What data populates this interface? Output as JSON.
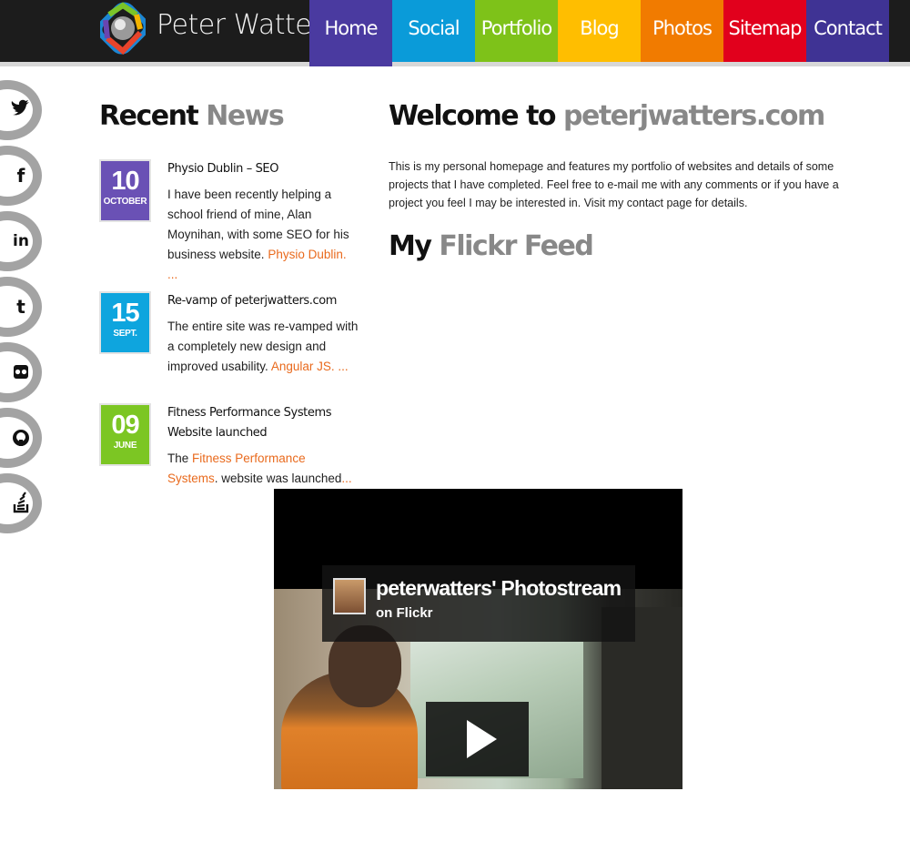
{
  "header": {
    "brand": "Peter Watters",
    "nav": [
      {
        "label": "Home",
        "color": "#4a3aa0",
        "active": true
      },
      {
        "label": "Social",
        "color": "#0a9bd9"
      },
      {
        "label": "Portfolio",
        "color": "#7ec219"
      },
      {
        "label": "Blog",
        "color": "#ffbe00"
      },
      {
        "label": "Photos",
        "color": "#f17b00"
      },
      {
        "label": "Sitemap",
        "color": "#e1001c"
      },
      {
        "label": "Contact",
        "color": "#3f3394"
      }
    ]
  },
  "social": {
    "items": [
      {
        "name": "twitter-icon",
        "glyph": "🐦"
      },
      {
        "name": "facebook-icon",
        "glyph": "f"
      },
      {
        "name": "linkedin-icon",
        "glyph": "in"
      },
      {
        "name": "tumblr-icon",
        "glyph": "t"
      },
      {
        "name": "flickr-icon",
        "glyph": "••"
      },
      {
        "name": "github-icon",
        "glyph": "◉"
      },
      {
        "name": "stackoverflow-icon",
        "glyph": "≡"
      }
    ]
  },
  "news": {
    "heading_main": "Recent",
    "heading_accent": "News",
    "items": [
      {
        "day": "10",
        "month": "OCTOBER",
        "color": "#6a51b5",
        "title": "Physio Dublin – SEO",
        "text": "I have been recently helping a school friend of mine, Alan Moynihan, with some SEO for his business website.",
        "link": "Physio Dublin. ..."
      },
      {
        "day": "15",
        "month": "SEPT.",
        "color": "#0ea5de",
        "title": "Re-vamp of peterjwatters.com",
        "text": "The entire site was re-vamped with a completely new design and improved usability.",
        "link": "Angular JS. ..."
      },
      {
        "day": "09",
        "month": "JUNE",
        "color": "#7cc623",
        "title": "Fitness Performance Systems Website launched",
        "text_pre": "The",
        "link": "Fitness Performance Systems",
        "text_post": ". website was launched",
        "tail": "..."
      }
    ]
  },
  "welcome": {
    "heading_main": "Welcome to",
    "heading_accent": "peterjwatters.com",
    "text": "This is my personal homepage and features my portfolio of websites and details of some projects that I have completed. Feel free to e-mail me with any comments or if you have a project you feel I may be interested in. Visit my contact page for details."
  },
  "flickr": {
    "heading_main": "My",
    "heading_accent": "Flickr Feed",
    "embed_title": "peterwatters' Photostream",
    "embed_sub": "on Flickr"
  }
}
